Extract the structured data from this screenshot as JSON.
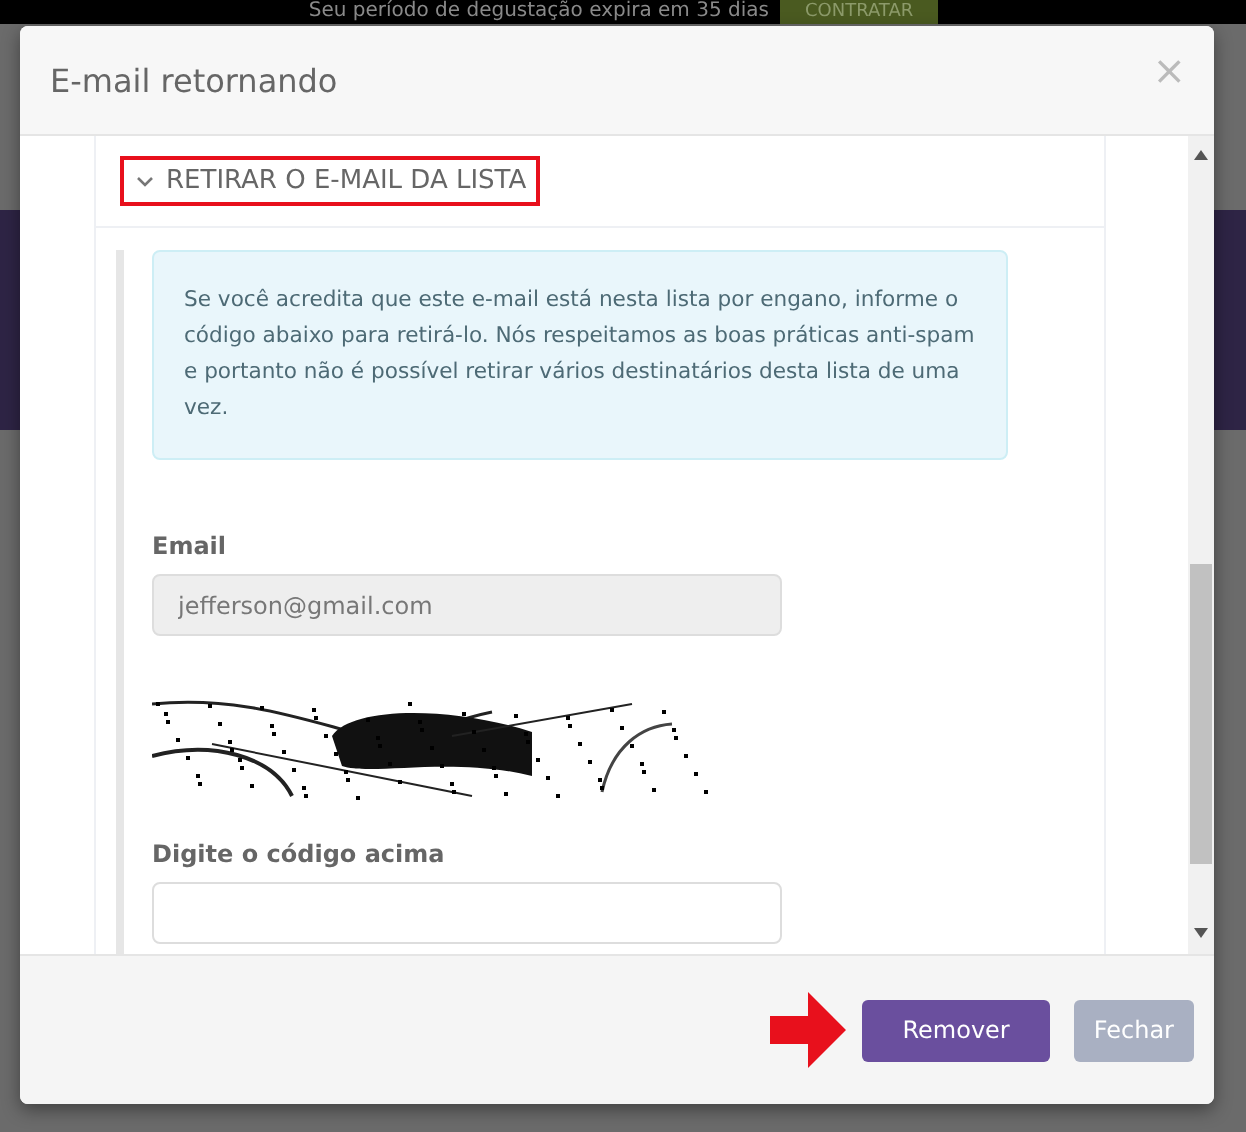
{
  "banner": {
    "text": "Seu período de degustação expira em 35 dias",
    "button": "CONTRATAR"
  },
  "modal": {
    "title": "E-mail retornando",
    "close": "×"
  },
  "section": {
    "title": "RETIRAR O E-MAIL DA LISTA",
    "expanded": true,
    "highlighted": true
  },
  "info": "Se você acredita que este e-mail está nesta lista por engano, informe o código abaixo para retirá-lo. Nós respeitamos as boas práticas anti-spam e portanto não é possível retirar vários destinatários desta lista de uma vez.",
  "email": {
    "label": "Email",
    "value": "jefferson@gmail.com",
    "disabled": true
  },
  "code": {
    "label": "Digite o código acima"
  },
  "buttons": [
    {
      "label": "Remover",
      "kind": "primary",
      "pointed": true
    },
    {
      "label": "Fechar",
      "kind": "secondary"
    }
  ]
}
